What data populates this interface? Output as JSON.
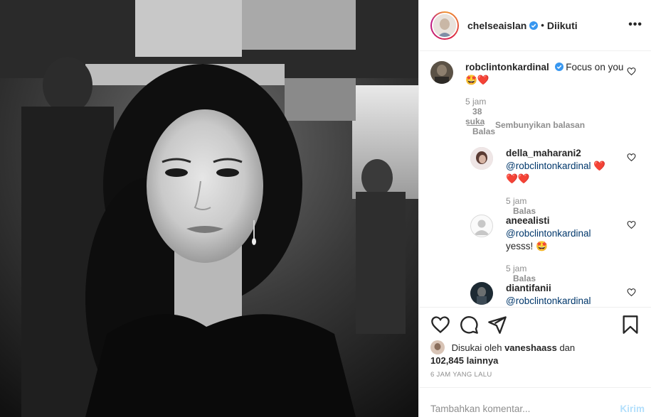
{
  "post": {
    "author": "chelseaislan",
    "follow_status": "Diikuti",
    "separator": "•",
    "more_label": "•••"
  },
  "comments": [
    {
      "user": "robclintonkardinal",
      "text": "Focus on you",
      "emoji": "🤩❤️",
      "time": "5 jam",
      "likes": "38 suka",
      "reply": "Balas",
      "verified": true
    }
  ],
  "hide_replies": "Sembunyikan balasan",
  "replies": [
    {
      "user": "della_maharani2",
      "mention": "@robclintonkardinal",
      "text": "❤️",
      "line2": "❤️❤️",
      "time": "5 jam",
      "reply": "Balas"
    },
    {
      "user": "aneealisti",
      "mention": "@robclintonkardinal",
      "text": "",
      "line2": "yesss! 🤩",
      "time": "5 jam",
      "reply": "Balas"
    },
    {
      "user": "diantifanii",
      "mention": "@robclintonkardinal",
      "text": "",
      "line2": "",
      "time": "",
      "reply": ""
    }
  ],
  "likes": {
    "prefix": "Disukai oleh",
    "user": "vaneshaass",
    "middle": "dan",
    "count": "102,845 lainnya"
  },
  "timestamp": "6 JAM YANG LALU",
  "add_comment": {
    "placeholder": "Tambahkan komentar...",
    "post_label": "Kirim"
  },
  "icons": {
    "like": "heart-icon",
    "comment": "comment-icon",
    "share": "share-icon",
    "save": "bookmark-icon"
  }
}
